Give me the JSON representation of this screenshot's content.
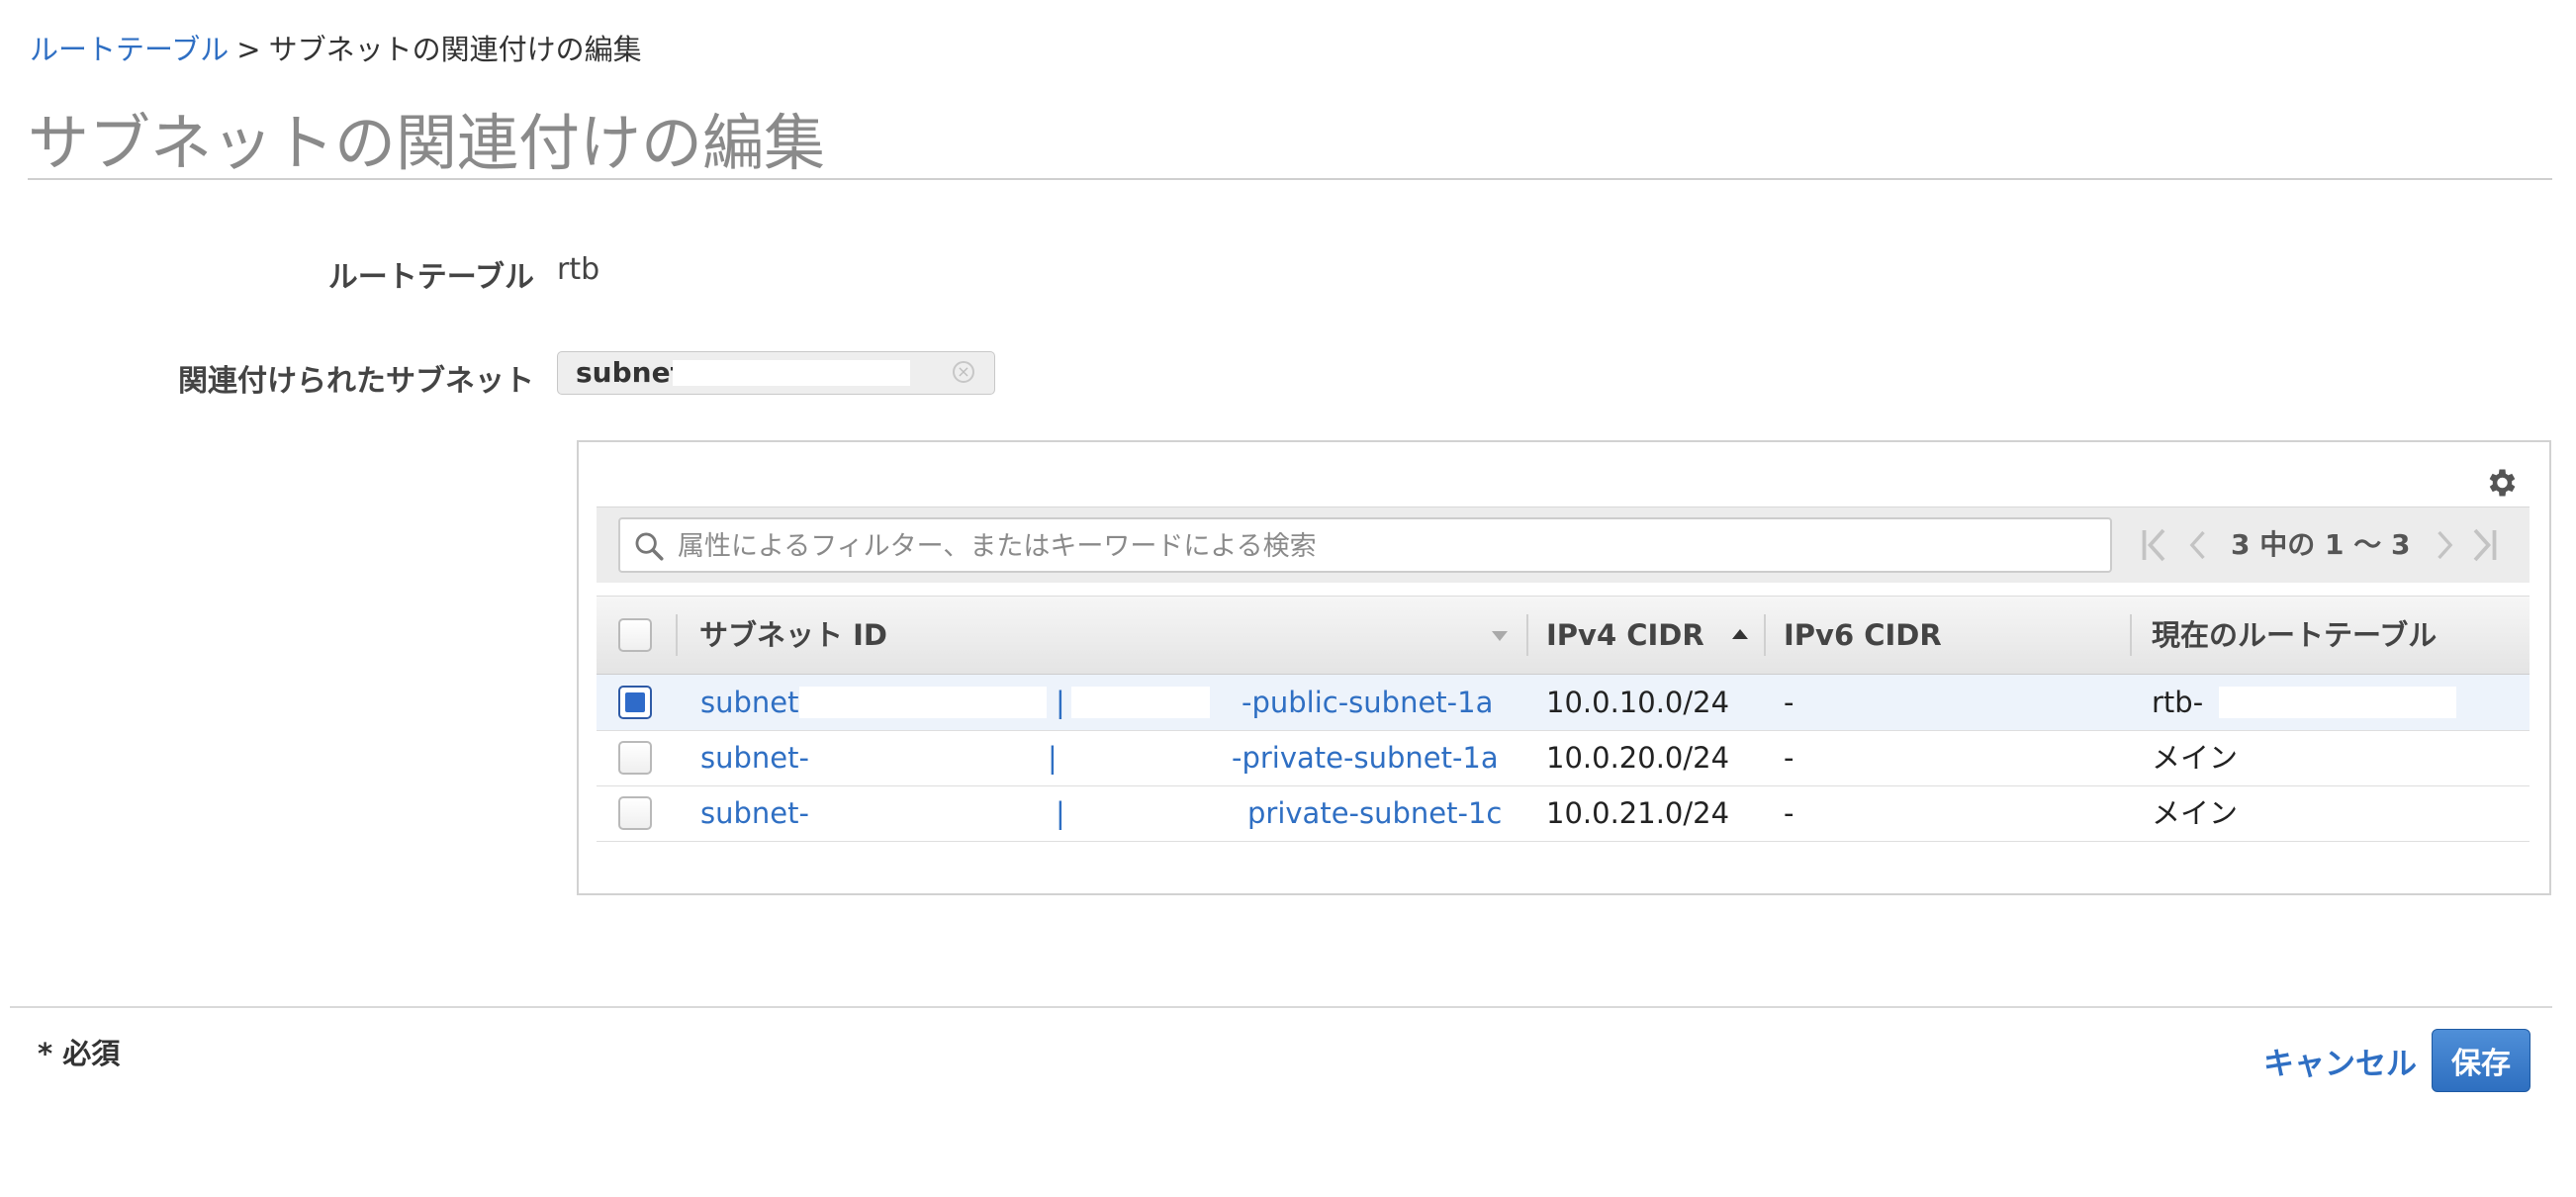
{
  "breadcrumb": {
    "parent": "ルートテーブル",
    "separator": ">",
    "current": "サブネットの関連付けの編集"
  },
  "page_title": "サブネットの関連付けの編集",
  "form": {
    "route_table_label": "ルートテーブル",
    "route_table_value": "rtb",
    "associated_subnets_label": "関連付けられたサブネット",
    "associated_subnet_tag": "subnet-"
  },
  "table": {
    "search_placeholder": "属性によるフィルター、またはキーワードによる検索",
    "pagination": "3 中の 1 〜 3",
    "columns": [
      "サブネット ID",
      "IPv4 CIDR",
      "IPv6 CIDR",
      "現在のルートテーブル"
    ],
    "rows": [
      {
        "checked": true,
        "subnet_prefix": "subnet-(",
        "bar": "|",
        "subnet_suffix": "-public-subnet-1a",
        "ipv4": "10.0.10.0/24",
        "ipv6": "-",
        "route_table": "rtb-"
      },
      {
        "checked": false,
        "subnet_prefix": "subnet-",
        "bar": "|",
        "subnet_suffix": "-private-subnet-1a",
        "ipv4": "10.0.20.0/24",
        "ipv6": "-",
        "route_table": "メイン"
      },
      {
        "checked": false,
        "subnet_prefix": "subnet-",
        "bar": "|",
        "subnet_suffix": "private-subnet-1c",
        "ipv4": "10.0.21.0/24",
        "ipv6": "-",
        "route_table": "メイン"
      }
    ]
  },
  "footer": {
    "required_note": "* 必須",
    "cancel_label": "キャンセル",
    "save_label": "保存"
  },
  "colors": {
    "link": "#2f6fc3",
    "primary_button": "#2e6fc0",
    "selected_row": "#edf3fb"
  },
  "icons": [
    "gear-icon",
    "search-icon",
    "first-page-icon",
    "prev-page-icon",
    "next-page-icon",
    "last-page-icon",
    "sort-desc-icon",
    "sort-asc-icon",
    "clear-icon"
  ]
}
